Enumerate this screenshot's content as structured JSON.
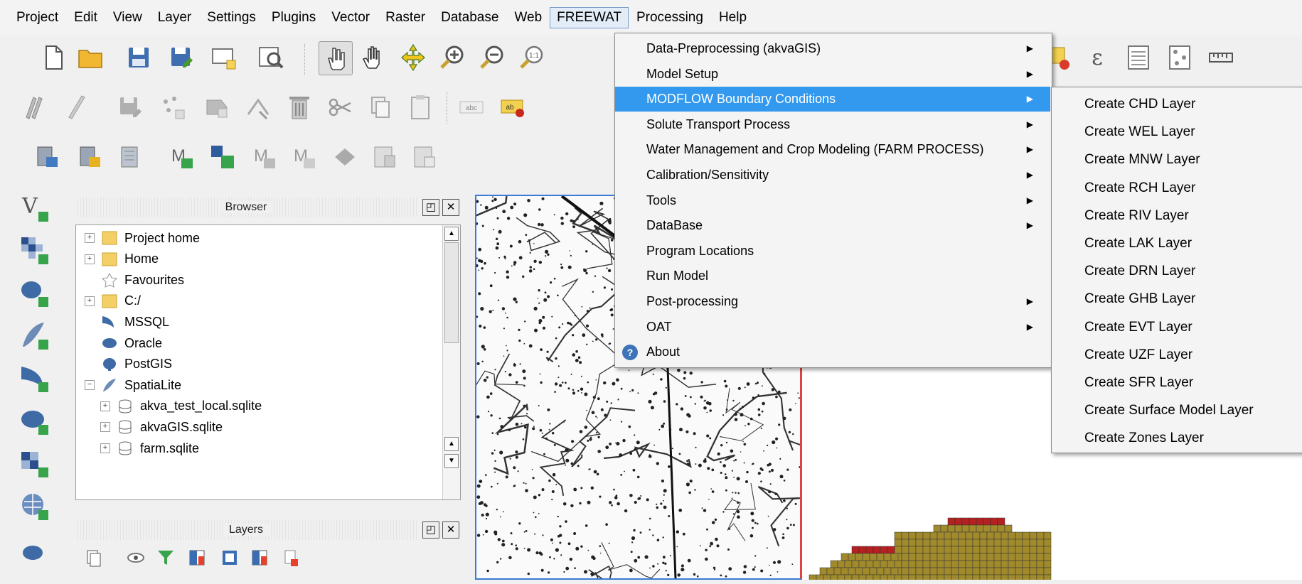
{
  "menubar": {
    "items": [
      "Project",
      "Edit",
      "View",
      "Layer",
      "Settings",
      "Plugins",
      "Vector",
      "Raster",
      "Database",
      "Web",
      "FREEWAT",
      "Processing",
      "Help"
    ],
    "active": "FREEWAT"
  },
  "freewat_menu": {
    "items": [
      {
        "label": "Data-Preprocessing (akvaGIS)",
        "submenu": true
      },
      {
        "label": "Model Setup",
        "submenu": true
      },
      {
        "label": "MODFLOW Boundary Conditions",
        "submenu": true,
        "highlighted": true
      },
      {
        "label": "Solute Transport Process",
        "submenu": true
      },
      {
        "label": "Water Management and Crop Modeling (FARM PROCESS)",
        "submenu": true
      },
      {
        "label": "Calibration/Sensitivity",
        "submenu": true
      },
      {
        "label": "Tools",
        "submenu": true
      },
      {
        "label": "DataBase",
        "submenu": true
      },
      {
        "label": "Program Locations",
        "submenu": false
      },
      {
        "label": "Run Model",
        "submenu": false
      },
      {
        "label": "Post-processing",
        "submenu": true
      },
      {
        "label": "OAT",
        "submenu": true
      },
      {
        "label": "About",
        "submenu": false,
        "icon": "about-icon"
      }
    ]
  },
  "boundary_submenu": {
    "items": [
      "Create CHD Layer",
      "Create WEL Layer",
      "Create MNW Layer",
      "Create RCH Layer",
      "Create RIV Layer",
      "Create LAK Layer",
      "Create DRN Layer",
      "Create GHB Layer",
      "Create EVT Layer",
      "Create UZF Layer",
      "Create SFR Layer",
      "Create Surface Model Layer",
      "Create Zones Layer"
    ]
  },
  "browser_panel": {
    "title": "Browser",
    "float_label": "◰",
    "close_label": "✕",
    "tree": [
      {
        "label": "Project home",
        "icon": "folder-icon",
        "expander": "+",
        "indent": 0
      },
      {
        "label": "Home",
        "icon": "folder-icon",
        "expander": "+",
        "indent": 0
      },
      {
        "label": "Favourites",
        "icon": "star-icon",
        "expander": "",
        "indent": 0
      },
      {
        "label": "C:/",
        "icon": "folder-icon",
        "expander": "+",
        "indent": 0
      },
      {
        "label": "MSSQL",
        "icon": "mssql-icon",
        "expander": "",
        "indent": 0
      },
      {
        "label": "Oracle",
        "icon": "oracle-icon",
        "expander": "",
        "indent": 0
      },
      {
        "label": "PostGIS",
        "icon": "postgis-icon",
        "expander": "",
        "indent": 0
      },
      {
        "label": "SpatiaLite",
        "icon": "spatialite-icon",
        "expander": "−",
        "indent": 0
      },
      {
        "label": "akva_test_local.sqlite",
        "icon": "database-icon",
        "expander": "+",
        "indent": 1
      },
      {
        "label": "akvaGIS.sqlite",
        "icon": "database-icon",
        "expander": "+",
        "indent": 1
      },
      {
        "label": "farm.sqlite",
        "icon": "database-icon",
        "expander": "+",
        "indent": 1
      }
    ]
  },
  "layers_panel": {
    "title": "Layers",
    "float_label": "◰",
    "close_label": "✕"
  },
  "colors": {
    "menu_highlight": "#3399ee",
    "map_border": "#3a7bd5",
    "grid_fill": "#a08a2c",
    "grid_edge": "#b52020"
  }
}
